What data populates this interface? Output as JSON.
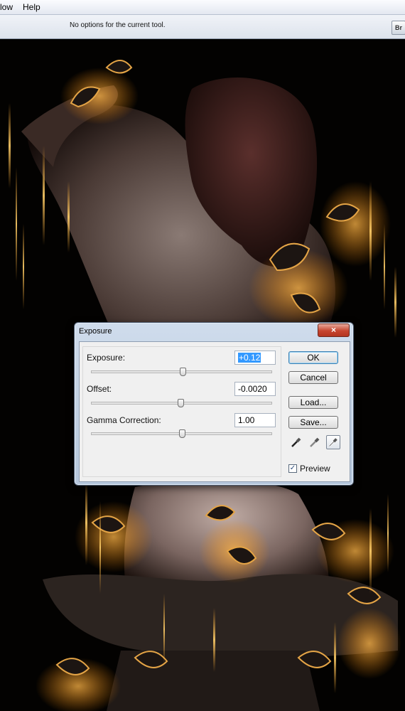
{
  "menubar": {
    "items": [
      "low",
      "Help"
    ]
  },
  "options_bar": {
    "text": "No options for the current tool.",
    "bridge_label": "Br"
  },
  "dialog": {
    "title": "Exposure",
    "close_label": "×",
    "exposure": {
      "label": "Exposure:",
      "value": "+0.12",
      "slider_fraction": 0.52
    },
    "offset": {
      "label": "Offset:",
      "value": "-0.0020",
      "slider_fraction": 0.5
    },
    "gamma": {
      "label": "Gamma Correction:",
      "value": "1.00",
      "slider_fraction": 0.51
    },
    "buttons": {
      "ok": "OK",
      "cancel": "Cancel",
      "load": "Load...",
      "save": "Save..."
    },
    "droppers": [
      "black-point-eyedropper-icon",
      "gray-point-eyedropper-icon",
      "white-point-eyedropper-icon"
    ],
    "preview": {
      "label": "Preview",
      "checked": true
    }
  },
  "colors": {
    "accent": "#f4a02a",
    "selection": "#3399ff",
    "close": "#c6452f"
  }
}
